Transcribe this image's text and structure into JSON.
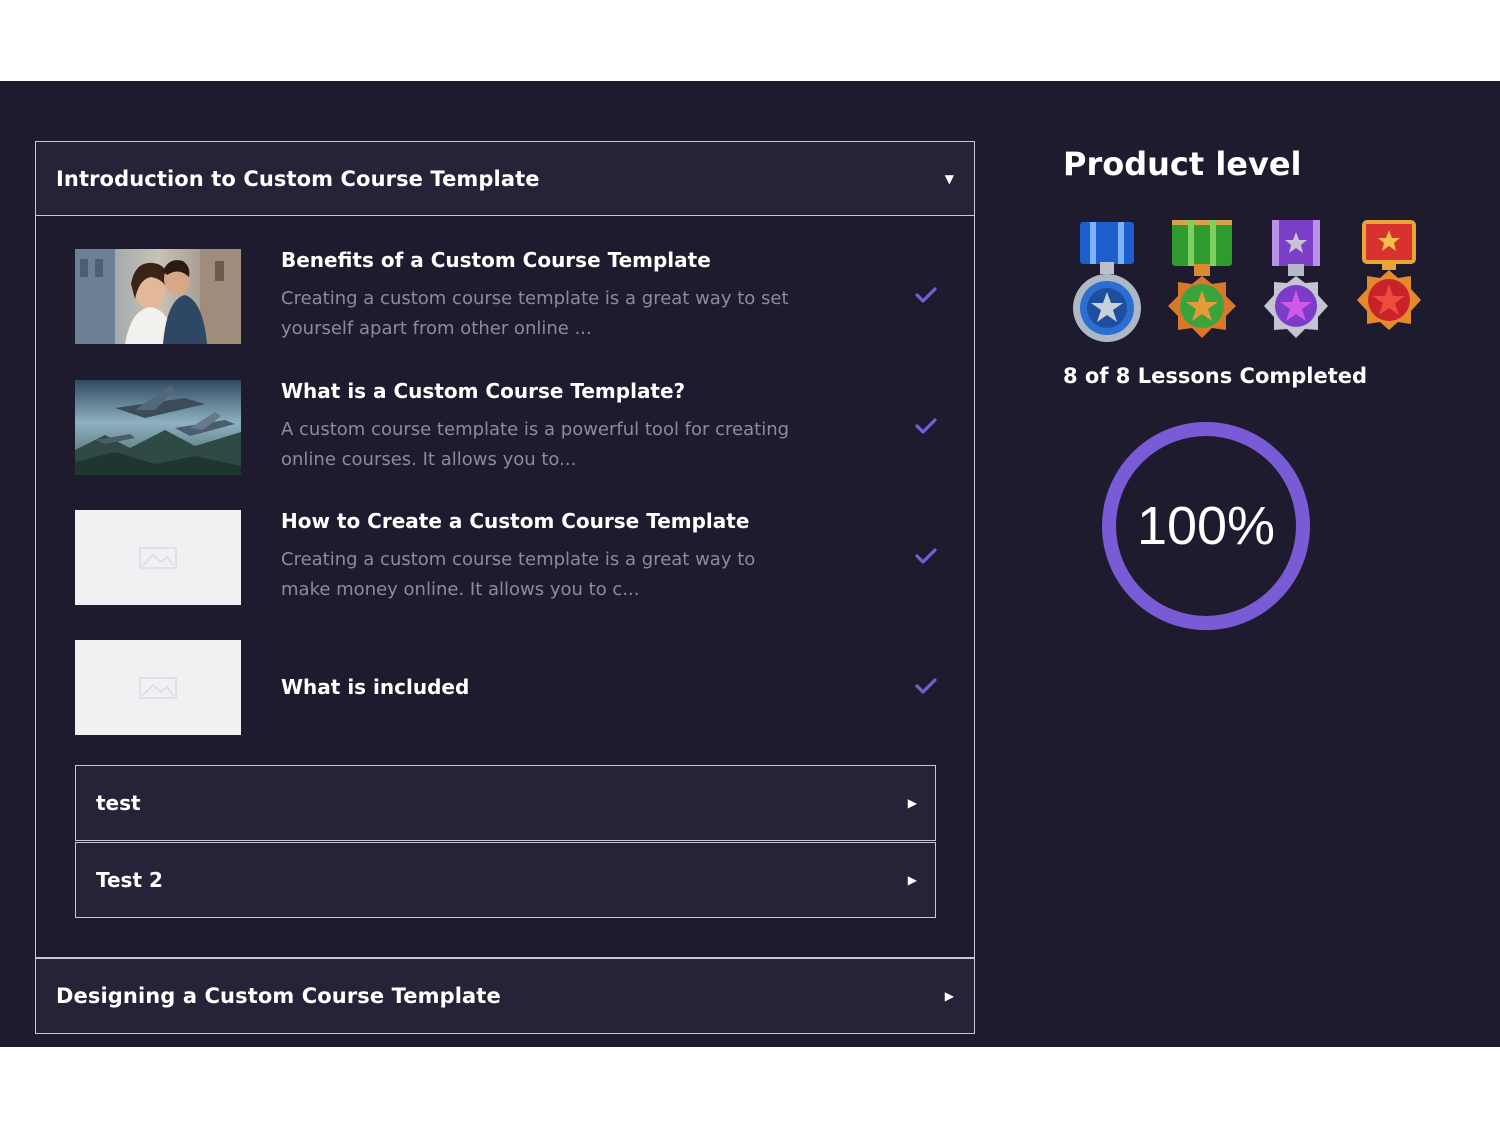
{
  "modules": [
    {
      "title": "Introduction to Custom Course Template",
      "expanded": true,
      "lessons": [
        {
          "title": "Benefits of a Custom Course Template",
          "desc": "Creating a custom course template is a great way to set yourself apart from other online ...",
          "completed": true,
          "thumb": "couple-photo"
        },
        {
          "title": "What is a Custom Course Template?",
          "desc": "A custom course template is a powerful tool for creating online courses. It allows you to...",
          "completed": true,
          "thumb": "spaceships-photo"
        },
        {
          "title": "How to Create a Custom Course Template",
          "desc": "Creating a custom course template is a great way to make money online. It allows you to c...",
          "completed": true,
          "thumb": "placeholder-image"
        },
        {
          "title": "What is included",
          "desc": "",
          "completed": true,
          "thumb": "placeholder-image"
        }
      ],
      "submodules": [
        {
          "title": "test"
        },
        {
          "title": "Test 2"
        }
      ]
    },
    {
      "title": "Designing a Custom Course Template",
      "expanded": false
    }
  ],
  "product_level": {
    "title": "Product level",
    "medals": [
      "blue-medal",
      "green-medal",
      "purple-medal",
      "red-medal"
    ],
    "lessons_completed": "8 of 8 Lessons Completed",
    "progress_percent": 100,
    "progress_label": "100%"
  },
  "colors": {
    "background": "#1e1b2e",
    "panel": "#262338",
    "accent": "#7a5bd6",
    "muted_text": "#8d8aa0"
  }
}
